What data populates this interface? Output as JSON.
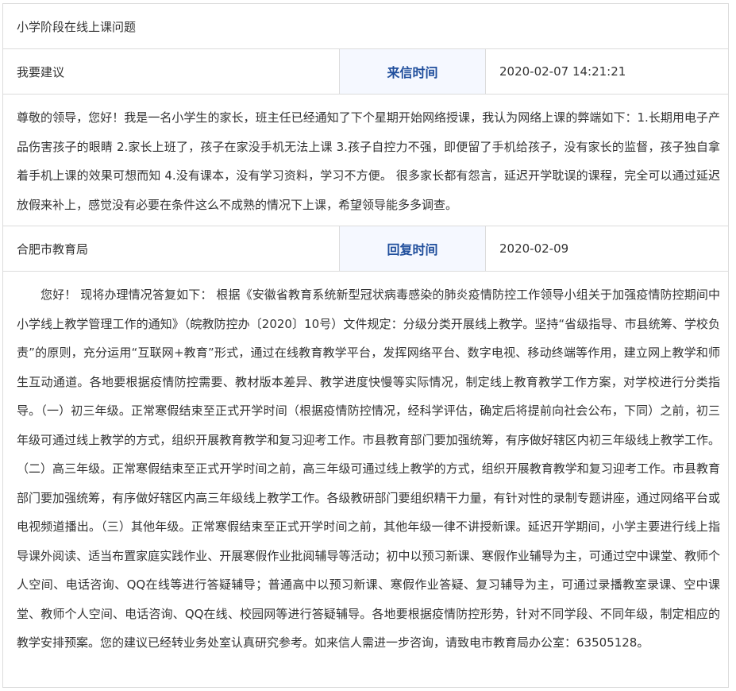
{
  "subject": "小学阶段在线上课问题",
  "letter": {
    "category": "我要建议",
    "time_label": "来信时间",
    "time_value": "2020-02-07 14:21:21",
    "content": "尊敬的领导，您好！我是一名小学生的家长，班主任已经通知了下个星期开始网络授课，我认为网络上课的弊端如下：1.长期用电子产品伤害孩子的眼睛 2.家长上班了，孩子在家没手机无法上课 3.孩子自控力不强，即便留了手机给孩子，没有家长的监督，孩子独自拿着手机上课的效果可想而知 4.没有课本，没有学习资料，学习不方便。 很多家长都有怨言，延迟开学耽误的课程，完全可以通过延迟放假来补上，感觉没有必要在条件这么不成熟的情况下上课，希望领导能多多调查。"
  },
  "reply": {
    "department": "合肥市教育局",
    "time_label": "回复时间",
    "time_value": "2020-02-09",
    "content": "您好！ 现将办理情况答复如下： 根据《安徽省教育系统新型冠状病毒感染的肺炎疫情防控工作领导小组关于加强疫情防控期间中小学线上教学管理工作的通知》（皖教防控办〔2020〕10号）文件规定：分级分类开展线上教学。坚持“省级指导、市县统筹、学校负责”的原则，充分运用“互联网+教育”形式，通过在线教育教学平台，发挥网络平台、数字电视、移动终端等作用，建立网上教学和师生互动通道。各地要根据疫情防控需要、教材版本差异、教学进度快慢等实际情况，制定线上教育教学工作方案，对学校进行分类指导。（一）初三年级。正常寒假结束至正式开学时间（根据疫情防控情况，经科学评估，确定后将提前向社会公布，下同）之前，初三年级可通过线上教学的方式，组织开展教育教学和复习迎考工作。市县教育部门要加强统筹，有序做好辖区内初三年级线上教学工作。（二）高三年级。正常寒假结束至正式开学时间之前，高三年级可通过线上教学的方式，组织开展教育教学和复习迎考工作。市县教育部门要加强统筹，有序做好辖区内高三年级线上教学工作。各级教研部门要组织精干力量，有针对性的录制专题讲座，通过网络平台或电视频道播出。（三）其他年级。正常寒假结束至正式开学时间之前，其他年级一律不讲授新课。延迟开学期间，小学主要进行线上指导课外阅读、适当布置家庭实践作业、开展寒假作业批阅辅导等活动；初中以预习新课、寒假作业辅导为主，可通过空中课堂、教师个人空间、电话咨询、QQ在线等进行答疑辅导；普通高中以预习新课、寒假作业答疑、复习辅导为主，可通过录播教室录课、空中课堂、教师个人空间、电话咨询、QQ在线、校园网等进行答疑辅导。各地要根据疫情防控形势，针对不同学段、不同年级，制定相应的教学安排预案。您的建议已经转业务处室认真研究参考。如来信人需进一步咨询，请致电市教育局办公室：63505128。"
  }
}
